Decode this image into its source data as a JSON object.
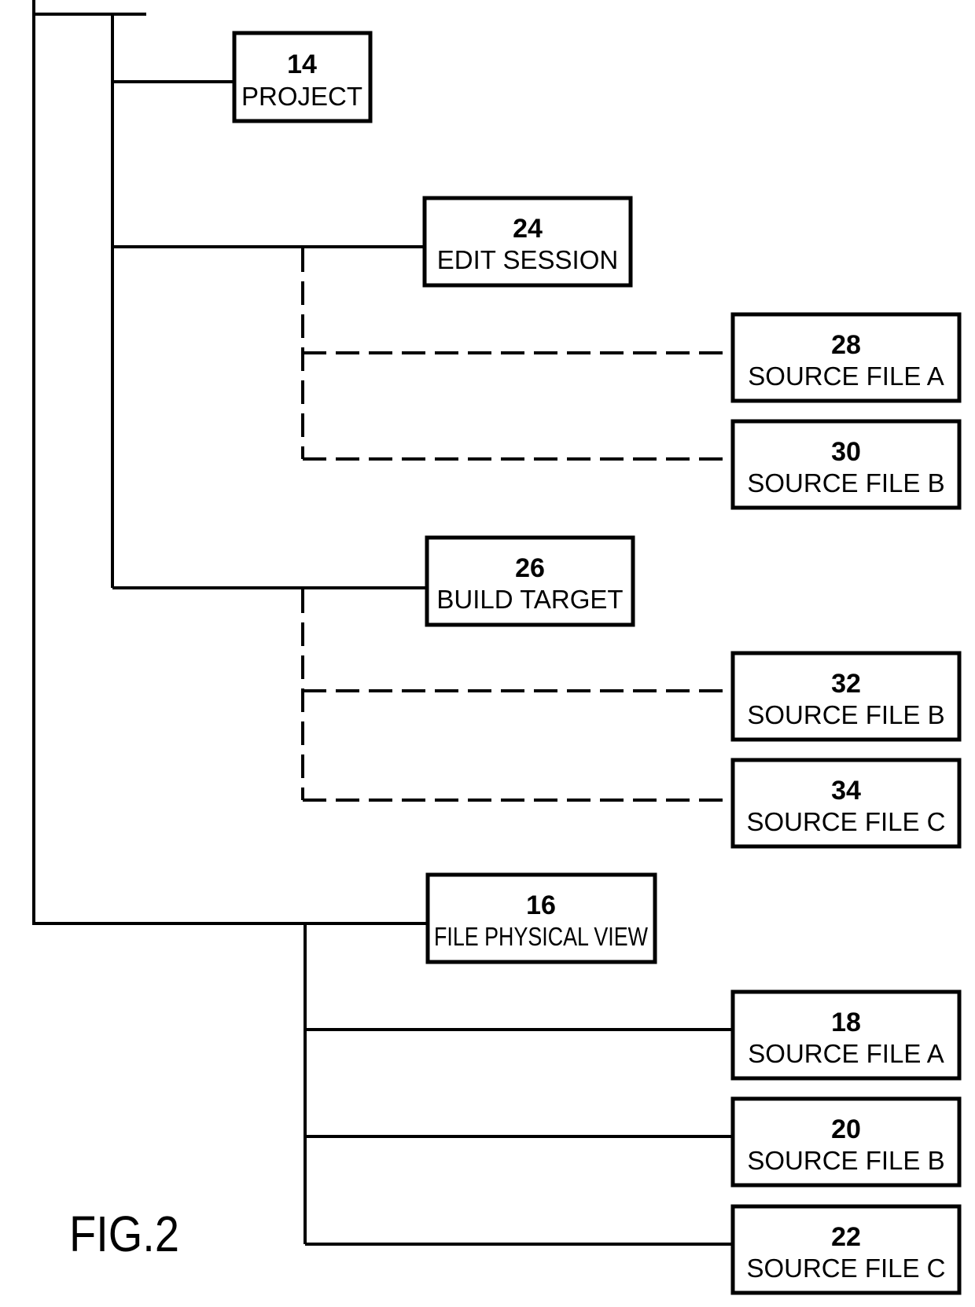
{
  "figure": {
    "caption": "FIG.2"
  },
  "nodes": {
    "project": {
      "ref": "14",
      "label": "PROJECT"
    },
    "edit_session": {
      "ref": "24",
      "label": "EDIT SESSION"
    },
    "edit_src_a": {
      "ref": "28",
      "label": "SOURCE FILE A"
    },
    "edit_src_b": {
      "ref": "30",
      "label": "SOURCE FILE B"
    },
    "build_target": {
      "ref": "26",
      "label": "BUILD TARGET"
    },
    "build_src_b": {
      "ref": "32",
      "label": "SOURCE FILE B"
    },
    "build_src_c": {
      "ref": "34",
      "label": "SOURCE FILE C"
    },
    "file_physical_view": {
      "ref": "16",
      "label": "FILE PHYSICAL VIEW"
    },
    "phys_src_a": {
      "ref": "18",
      "label": "SOURCE FILE A"
    },
    "phys_src_b": {
      "ref": "20",
      "label": "SOURCE FILE B"
    },
    "phys_src_c": {
      "ref": "22",
      "label": "SOURCE FILE C"
    }
  },
  "edges": [
    {
      "from": "root",
      "to": "project",
      "style": "solid"
    },
    {
      "from": "root",
      "to": "edit_session",
      "style": "solid"
    },
    {
      "from": "edit_session",
      "to": "edit_src_a",
      "style": "dashed"
    },
    {
      "from": "edit_session",
      "to": "edit_src_b",
      "style": "dashed"
    },
    {
      "from": "root",
      "to": "build_target",
      "style": "solid"
    },
    {
      "from": "build_target",
      "to": "build_src_b",
      "style": "dashed"
    },
    {
      "from": "build_target",
      "to": "build_src_c",
      "style": "dashed"
    },
    {
      "from": "root",
      "to": "file_physical_view",
      "style": "solid"
    },
    {
      "from": "file_physical_view",
      "to": "phys_src_a",
      "style": "solid"
    },
    {
      "from": "file_physical_view",
      "to": "phys_src_b",
      "style": "solid"
    },
    {
      "from": "file_physical_view",
      "to": "phys_src_c",
      "style": "solid"
    }
  ]
}
